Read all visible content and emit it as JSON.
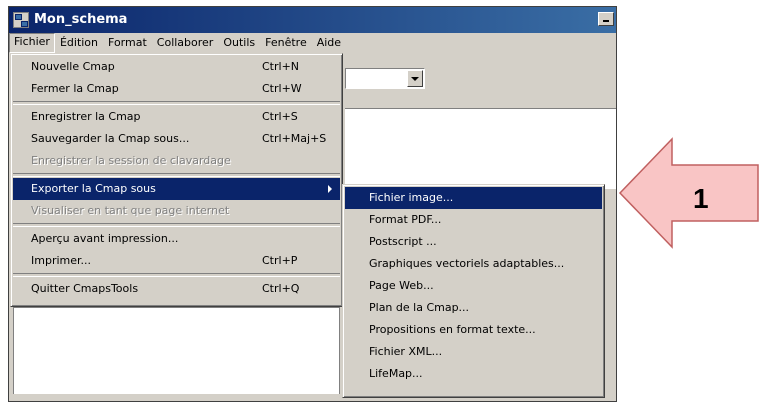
{
  "window": {
    "title": "Mon_schema"
  },
  "menubar": [
    "Fichier",
    "Édition",
    "Format",
    "Collaborer",
    "Outils",
    "Fenêtre",
    "Aide"
  ],
  "file_menu": [
    {
      "label": "Nouvelle Cmap",
      "shortcut": "Ctrl+N",
      "state": "enabled"
    },
    {
      "label": "Fermer la Cmap",
      "shortcut": "Ctrl+W",
      "state": "enabled"
    },
    {
      "separator": true
    },
    {
      "label": "Enregistrer la Cmap",
      "shortcut": "Ctrl+S",
      "state": "enabled"
    },
    {
      "label": "Sauvegarder la Cmap sous...",
      "shortcut": "Ctrl+Maj+S",
      "state": "enabled"
    },
    {
      "label": "Enregistrer la session de clavardage",
      "shortcut": "",
      "state": "disabled"
    },
    {
      "separator": true
    },
    {
      "label": "Exporter la Cmap sous",
      "shortcut": "",
      "state": "highlighted",
      "submenu": true
    },
    {
      "label": "Visualiser en tant que page internet",
      "shortcut": "",
      "state": "disabled"
    },
    {
      "separator": true
    },
    {
      "label": "Aperçu avant impression...",
      "shortcut": "",
      "state": "enabled"
    },
    {
      "label": "Imprimer...",
      "shortcut": "Ctrl+P",
      "state": "enabled"
    },
    {
      "separator": true
    },
    {
      "label": "Quitter CmapsTools",
      "shortcut": "Ctrl+Q",
      "state": "enabled"
    }
  ],
  "export_submenu": [
    {
      "label": "Fichier image...",
      "state": "highlighted"
    },
    {
      "label": "Format PDF...",
      "state": "enabled"
    },
    {
      "label": "Postscript ...",
      "state": "enabled"
    },
    {
      "label": "Graphiques vectoriels adaptables...",
      "state": "enabled"
    },
    {
      "label": "Page Web...",
      "state": "enabled"
    },
    {
      "label": "Plan de la Cmap...",
      "state": "enabled"
    },
    {
      "label": "Propositions en format texte...",
      "state": "enabled"
    },
    {
      "label": "Fichier XML...",
      "state": "enabled"
    },
    {
      "label": "LifeMap...",
      "state": "enabled"
    }
  ],
  "callout": {
    "number": "1",
    "fill": "#f9c5c5",
    "stroke": "#c06060",
    "points_to": "Fichier image..."
  },
  "colors": {
    "highlight": "#0a246a",
    "face": "#d4d0c8",
    "titlebar": "#0a246a"
  }
}
